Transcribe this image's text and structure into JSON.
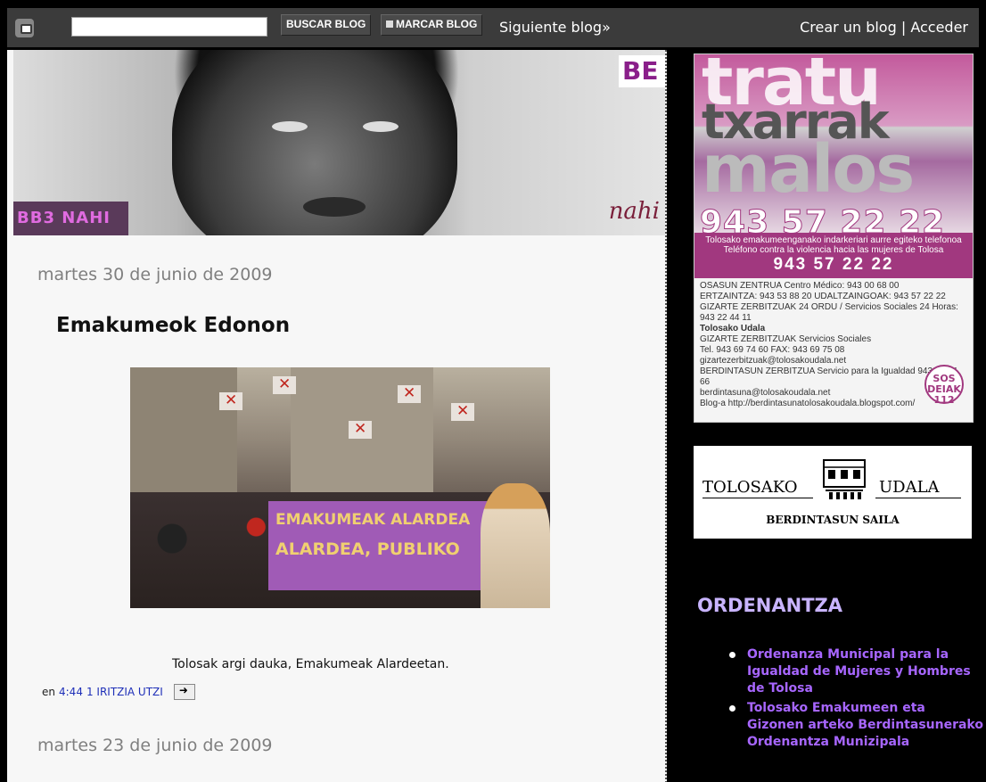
{
  "navbar": {
    "search_placeholder": "",
    "search_button": "BUSCAR BLOG",
    "mark_button": "MARCAR BLOG",
    "next_blog": "Siguiente blog»",
    "right_links": "Crear un blog | Acceder"
  },
  "header": {
    "corner_text": "BB3 NAHI",
    "top_right_text": "BE",
    "script_text": "nahi"
  },
  "posts": [
    {
      "date": "martes 30 de junio de 2009",
      "title": "Emakumeok Edonon",
      "image_banner_line1": "EMAKUMEAK ALARDEA",
      "image_banner_line2": "ALARDEA, PUBLIKO",
      "caption": "Tolosak argi dauka, Emakumeak Alardeetan.",
      "footer_prefix": "en",
      "time": "4:44",
      "comments": "1 IRITZIA UTZI"
    },
    {
      "date": "martes 23 de junio de 2009"
    }
  ],
  "sidebar": {
    "poster": {
      "line1": "tratu",
      "line2": "txarrak",
      "line3": "malos",
      "phone_big": "943 57 22 22",
      "band_text": "Tolosako emakumeenganako indarkeriari aurre egiteko telefonoa",
      "band_sub": "Teléfono contra la violencia hacia las mujeres de Tolosa",
      "phone": "943 57 22 22",
      "info_lines": [
        "OSASUN ZENTRUA Centro Médico: 943 00 68 00",
        "ERTZAINTZA: 943 53 88 20   UDALTZAINGOAK: 943 57 22 22",
        "GIZARTE ZERBITZUAK 24 ORDU / Servicios Sociales 24 Horas: 943 22 44 11",
        "Tolosako Udala",
        "GIZARTE ZERBITZUAK Servicios Sociales",
        "Tel. 943 69 74 60   FAX: 943 69 75 08",
        "gizartezerbitzuak@tolosakoudala.net",
        "BERDINTASUN ZERBITZUA Servicio para la Igualdad 943 65 44 66",
        "berdintasuna@tolosakoudala.net",
        "Blog-a http://berdintasunatolosakoudala.blogspot.com/"
      ],
      "sos_text": "SOS DEIAK 112"
    },
    "logo": {
      "left": "TOLOSAKO",
      "right": "UDALA",
      "sub": "BERDINTASUN SAILA"
    },
    "section_title": "ORDENANTZA",
    "links": [
      "Ordenanza Municipal para la Igualdad de Mujeres y Hombres de Tolosa",
      "Tolosako Emakumeen eta Gizonen arteko Berdintasunerako Ordenantza Munizipala"
    ]
  },
  "colors": {
    "navbar_bg": "#3b3b3b",
    "page_bg": "#000000",
    "main_bg": "#f7f7f7",
    "link_blue": "#1e2fb8",
    "sidebar_title": "#c8b4ff",
    "sidebar_link": "#a766ff",
    "poster_accent": "#a1387f"
  }
}
